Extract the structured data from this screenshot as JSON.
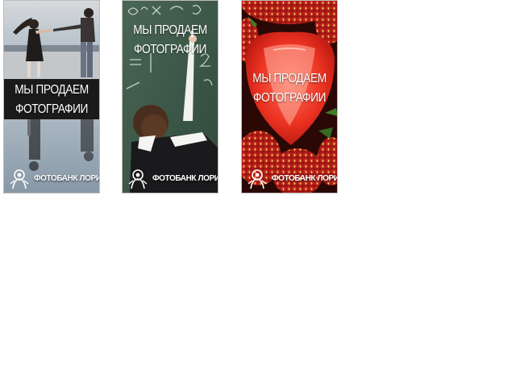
{
  "banners": [
    {
      "headline_line1": "МЫ ПРОДАЕМ",
      "headline_line2": "ФОТОГРАФИИ",
      "brand": "ФОТОБАНК ЛОРИ",
      "theme": "couple-beach"
    },
    {
      "headline_line1": "МЫ ПРОДАЕМ",
      "headline_line2": "ФОТОГРАФИИ",
      "brand": "ФОТОБАНК ЛОРИ",
      "theme": "schoolboy-chalkboard"
    },
    {
      "headline_line1": "МЫ ПРОДАЕМ",
      "headline_line2": "ФОТОГРАФИИ",
      "brand": "ФОТОБАНК ЛОРИ",
      "theme": "strawberries"
    }
  ],
  "colors": {
    "text": "#ffffff",
    "border": "#bdbdbd",
    "strawberry_red": "#d7261c",
    "chalkboard_green": "#3e5a48",
    "sky": "#c9d6df"
  }
}
